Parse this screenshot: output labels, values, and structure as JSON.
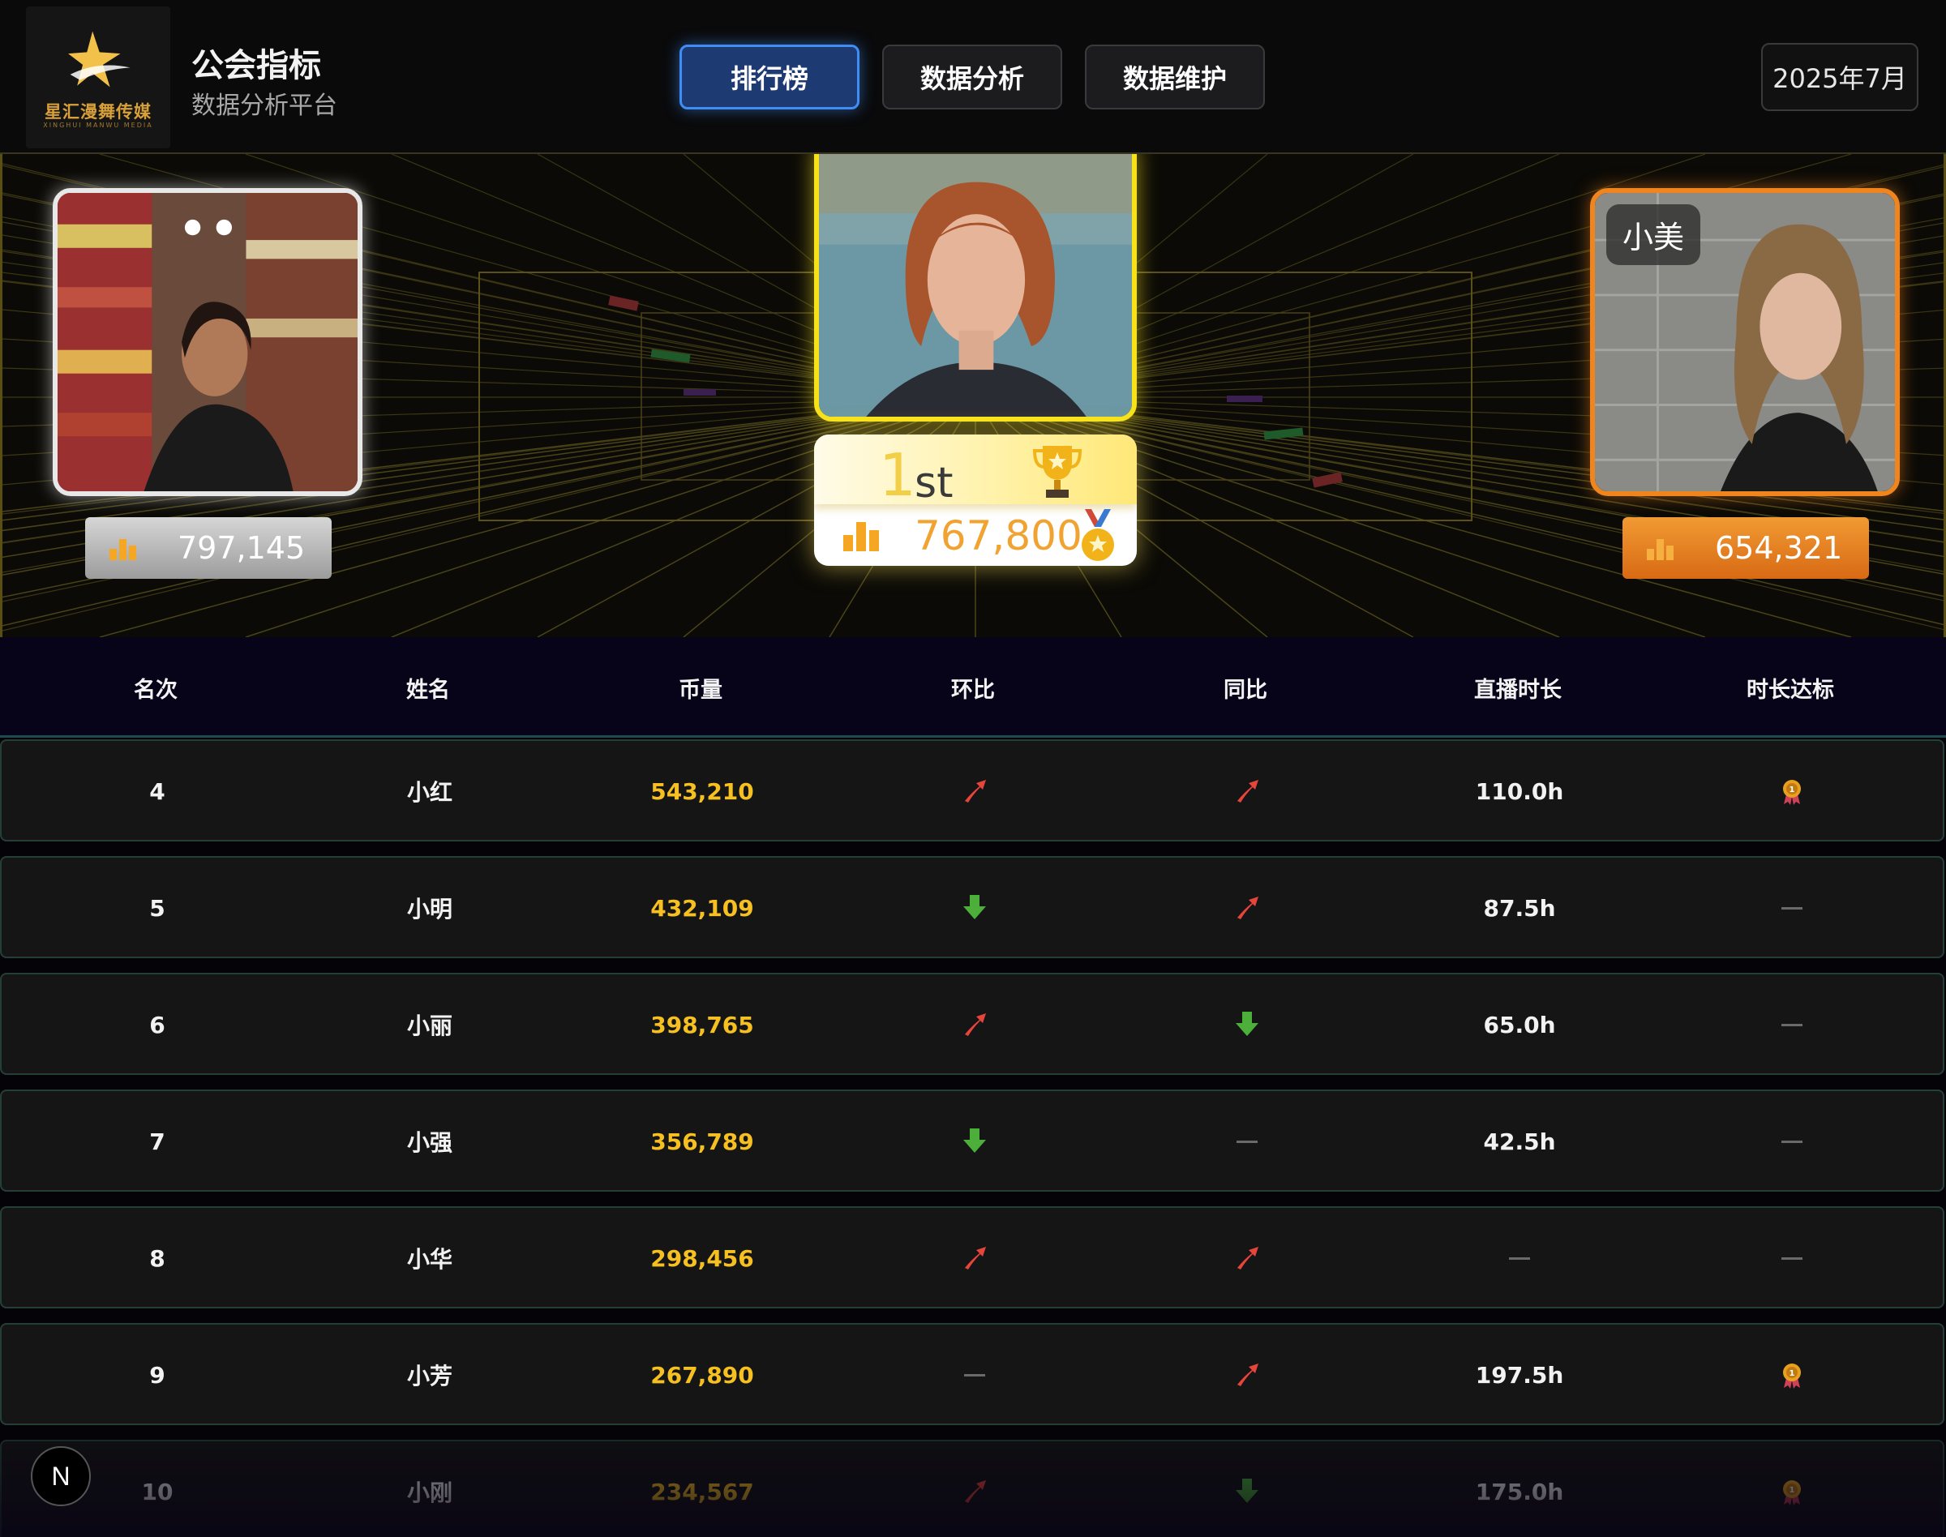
{
  "header": {
    "logo_text": "星汇漫舞传媒",
    "logo_sub": "XINGHUI MANWU MEDIA",
    "title": "公会指标",
    "subtitle": "数据分析平台",
    "nav": [
      {
        "label": "排行榜",
        "active": true
      },
      {
        "label": "数据分析",
        "active": false
      },
      {
        "label": "数据维护",
        "active": false
      }
    ],
    "date": "2025年7月"
  },
  "podium": {
    "second": {
      "score": "797,145",
      "color": "#e8e8e8"
    },
    "first": {
      "rank": "1",
      "suffix": "st",
      "score": "767,800",
      "color": "#f7e21a"
    },
    "third": {
      "name": "小美",
      "score": "654,321",
      "color": "#f0851e"
    }
  },
  "table": {
    "columns": [
      "名次",
      "姓名",
      "币量",
      "环比",
      "同比",
      "直播时长",
      "时长达标"
    ],
    "rows": [
      {
        "rank": "4",
        "name": "小红",
        "coins": "543,210",
        "mom": "up",
        "yoy": "up",
        "hours": "110.0h",
        "badge": "medal"
      },
      {
        "rank": "5",
        "name": "小明",
        "coins": "432,109",
        "mom": "down",
        "yoy": "up",
        "hours": "87.5h",
        "badge": "none"
      },
      {
        "rank": "6",
        "name": "小丽",
        "coins": "398,765",
        "mom": "up",
        "yoy": "down",
        "hours": "65.0h",
        "badge": "none"
      },
      {
        "rank": "7",
        "name": "小强",
        "coins": "356,789",
        "mom": "down",
        "yoy": "none",
        "hours": "42.5h",
        "badge": "none"
      },
      {
        "rank": "8",
        "name": "小华",
        "coins": "298,456",
        "mom": "up",
        "yoy": "up",
        "hours": "",
        "badge": "none"
      },
      {
        "rank": "9",
        "name": "小芳",
        "coins": "267,890",
        "mom": "none",
        "yoy": "up",
        "hours": "197.5h",
        "badge": "medal"
      },
      {
        "rank": "10",
        "name": "小刚",
        "coins": "234,567",
        "mom": "up",
        "yoy": "down",
        "hours": "175.0h",
        "badge": "medal"
      }
    ]
  },
  "floating_badge": "N"
}
